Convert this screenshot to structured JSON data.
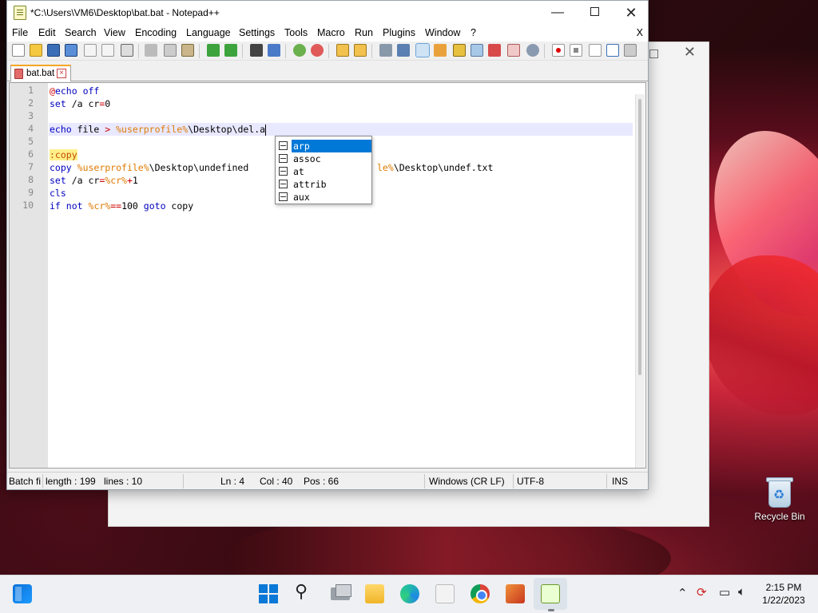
{
  "window": {
    "title": "*C:\\Users\\VM6\\Desktop\\bat.bat - Notepad++",
    "min_glyph": "—",
    "close_glyph": "✕"
  },
  "menu": {
    "items": [
      "File",
      "Edit",
      "Search",
      "View",
      "Encoding",
      "Language",
      "Settings",
      "Tools",
      "Macro",
      "Run",
      "Plugins",
      "Window",
      "?"
    ],
    "close": "X"
  },
  "tab": {
    "label": "bat.bat",
    "close": "×"
  },
  "editor": {
    "line_numbers": [
      "1",
      "2",
      "3",
      "4",
      "5",
      "6",
      "7",
      "8",
      "9",
      "10"
    ],
    "lines": [
      [
        {
          "t": "@",
          "c": "op"
        },
        {
          "t": "echo",
          "c": "kw"
        },
        {
          "t": " off",
          "c": "kw"
        }
      ],
      [
        {
          "t": "set",
          "c": "kw"
        },
        {
          "t": " /a cr",
          "c": ""
        },
        {
          "t": "=",
          "c": "op"
        },
        {
          "t": "0",
          "c": "num"
        }
      ],
      [],
      [
        {
          "t": "echo",
          "c": "kw"
        },
        {
          "t": " file ",
          "c": ""
        },
        {
          "t": ">",
          "c": "op"
        },
        {
          "t": " ",
          "c": ""
        },
        {
          "t": "%userprofile%",
          "c": "var"
        },
        {
          "t": "\\Desktop\\del.a",
          "c": ""
        }
      ],
      [],
      [
        {
          "t": ":copy",
          "c": "lbl-hl"
        }
      ],
      [
        {
          "t": "copy",
          "c": "kw"
        },
        {
          "t": " ",
          "c": ""
        },
        {
          "t": "%userprofile%",
          "c": "var"
        },
        {
          "t": "\\Desktop\\undefine",
          "c": ""
        },
        {
          "t": "d",
          "c": ""
        }
      ],
      [
        {
          "t": "set",
          "c": "kw"
        },
        {
          "t": " /a cr",
          "c": ""
        },
        {
          "t": "=",
          "c": "op"
        },
        {
          "t": "%cr%",
          "c": "var"
        },
        {
          "t": "+",
          "c": "op"
        },
        {
          "t": "1",
          "c": "num"
        }
      ],
      [
        {
          "t": "cls",
          "c": "kw"
        }
      ],
      [
        {
          "t": "if",
          "c": "kw"
        },
        {
          "t": " ",
          "c": ""
        },
        {
          "t": "not",
          "c": "kw"
        },
        {
          "t": " ",
          "c": ""
        },
        {
          "t": "%cr%",
          "c": "var"
        },
        {
          "t": "==",
          "c": "op"
        },
        {
          "t": "100",
          "c": "num"
        },
        {
          "t": " ",
          "c": ""
        },
        {
          "t": "goto",
          "c": "kw"
        },
        {
          "t": " copy",
          "c": ""
        }
      ]
    ],
    "line7_tail": [
      {
        "t": "le%",
        "c": "var"
      },
      {
        "t": "\\Desktop\\undef.txt",
        "c": ""
      }
    ]
  },
  "autocomplete": {
    "items": [
      "arp",
      "assoc",
      "at",
      "attrib",
      "aux"
    ],
    "selected": 0
  },
  "status": {
    "type": "Batch fi",
    "length": "length : 199",
    "lines": "lines : 10",
    "ln": "Ln : 4",
    "col": "Col : 40",
    "pos": "Pos : 66",
    "eol": "Windows (CR LF)",
    "encoding": "UTF-8",
    "mode": "INS"
  },
  "desktop": {
    "recycle_bin": "Recycle Bin"
  },
  "taskbar": {
    "time": "2:15 PM",
    "date": "1/22/2023",
    "tray_icons": [
      "chevron-up-icon",
      "sync-icon",
      "network-icon",
      "volume-icon"
    ],
    "apps": [
      "start-icon",
      "windows-icon",
      "search-icon",
      "task-view-icon",
      "file-explorer-icon",
      "edge-icon",
      "store-icon",
      "chrome-icon",
      "paint-icon",
      "notepadpp-icon"
    ]
  },
  "colors": {
    "keyword": "#0000c0",
    "variable": "#e07a00",
    "operator": "#c00000",
    "current_line": "#e8e8ff",
    "selection": "#0078d7"
  }
}
